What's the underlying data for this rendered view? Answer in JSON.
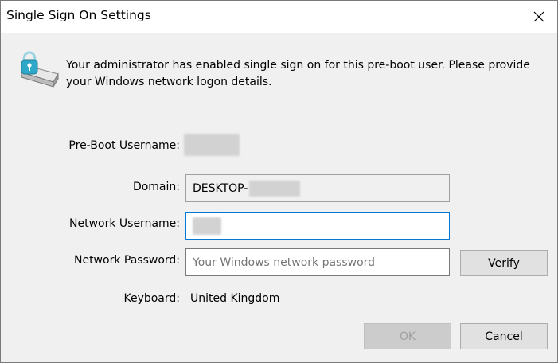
{
  "window": {
    "title": "Single Sign On Settings",
    "close_icon": "close-icon"
  },
  "message": {
    "icon": "lock-drive-icon",
    "text": "Your administrator has enabled single sign on for this pre-boot user.  Please provide your Windows network logon details."
  },
  "form": {
    "preboot_username_label": "Pre-Boot Username:",
    "domain_label": "Domain:",
    "domain_value": "DESKTOP-",
    "network_username_label": "Network Username:",
    "network_password_label": "Network Password:",
    "network_password_placeholder": "Your Windows network password",
    "keyboard_label": "Keyboard:",
    "keyboard_value": "United Kingdom"
  },
  "buttons": {
    "verify": "Verify",
    "ok": "OK",
    "cancel": "Cancel"
  },
  "colors": {
    "focus_border": "#0078d7",
    "icon_accent": "#2fa7c8"
  }
}
